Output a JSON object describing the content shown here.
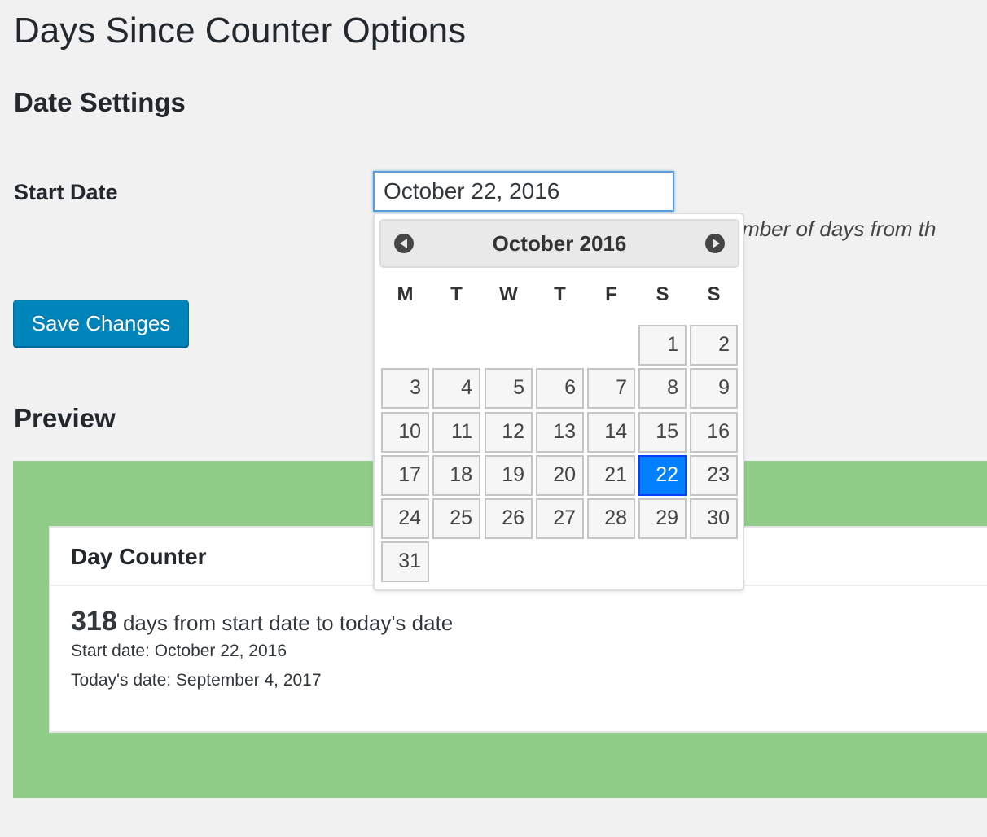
{
  "page": {
    "title": "Days Since Counter Options",
    "date_settings_title": "Date Settings",
    "start_date_label": "Start Date",
    "start_date_value": "October 22, 2016",
    "description": "he number of days from th",
    "save_button": "Save Changes",
    "preview_title": "Preview"
  },
  "preview": {
    "background_color": "#8ecc87",
    "card_title": "Day Counter",
    "count": "318",
    "count_text": "days from start date to today's date",
    "start_date_line": "Start date: October 22, 2016",
    "today_date_line": "Today's date: September 4, 2017"
  },
  "datepicker": {
    "title": "October 2016",
    "prev_icon": "circle-arrow-left-icon",
    "next_icon": "circle-arrow-right-icon",
    "weekdays": [
      "M",
      "T",
      "W",
      "T",
      "F",
      "S",
      "S"
    ],
    "first_weekday_index": 5,
    "days": [
      "1",
      "2",
      "3",
      "4",
      "5",
      "6",
      "7",
      "8",
      "9",
      "10",
      "11",
      "12",
      "13",
      "14",
      "15",
      "16",
      "17",
      "18",
      "19",
      "20",
      "21",
      "22",
      "23",
      "24",
      "25",
      "26",
      "27",
      "28",
      "29",
      "30",
      "31"
    ],
    "selected_day": "22",
    "selected_color": "#007fff"
  }
}
